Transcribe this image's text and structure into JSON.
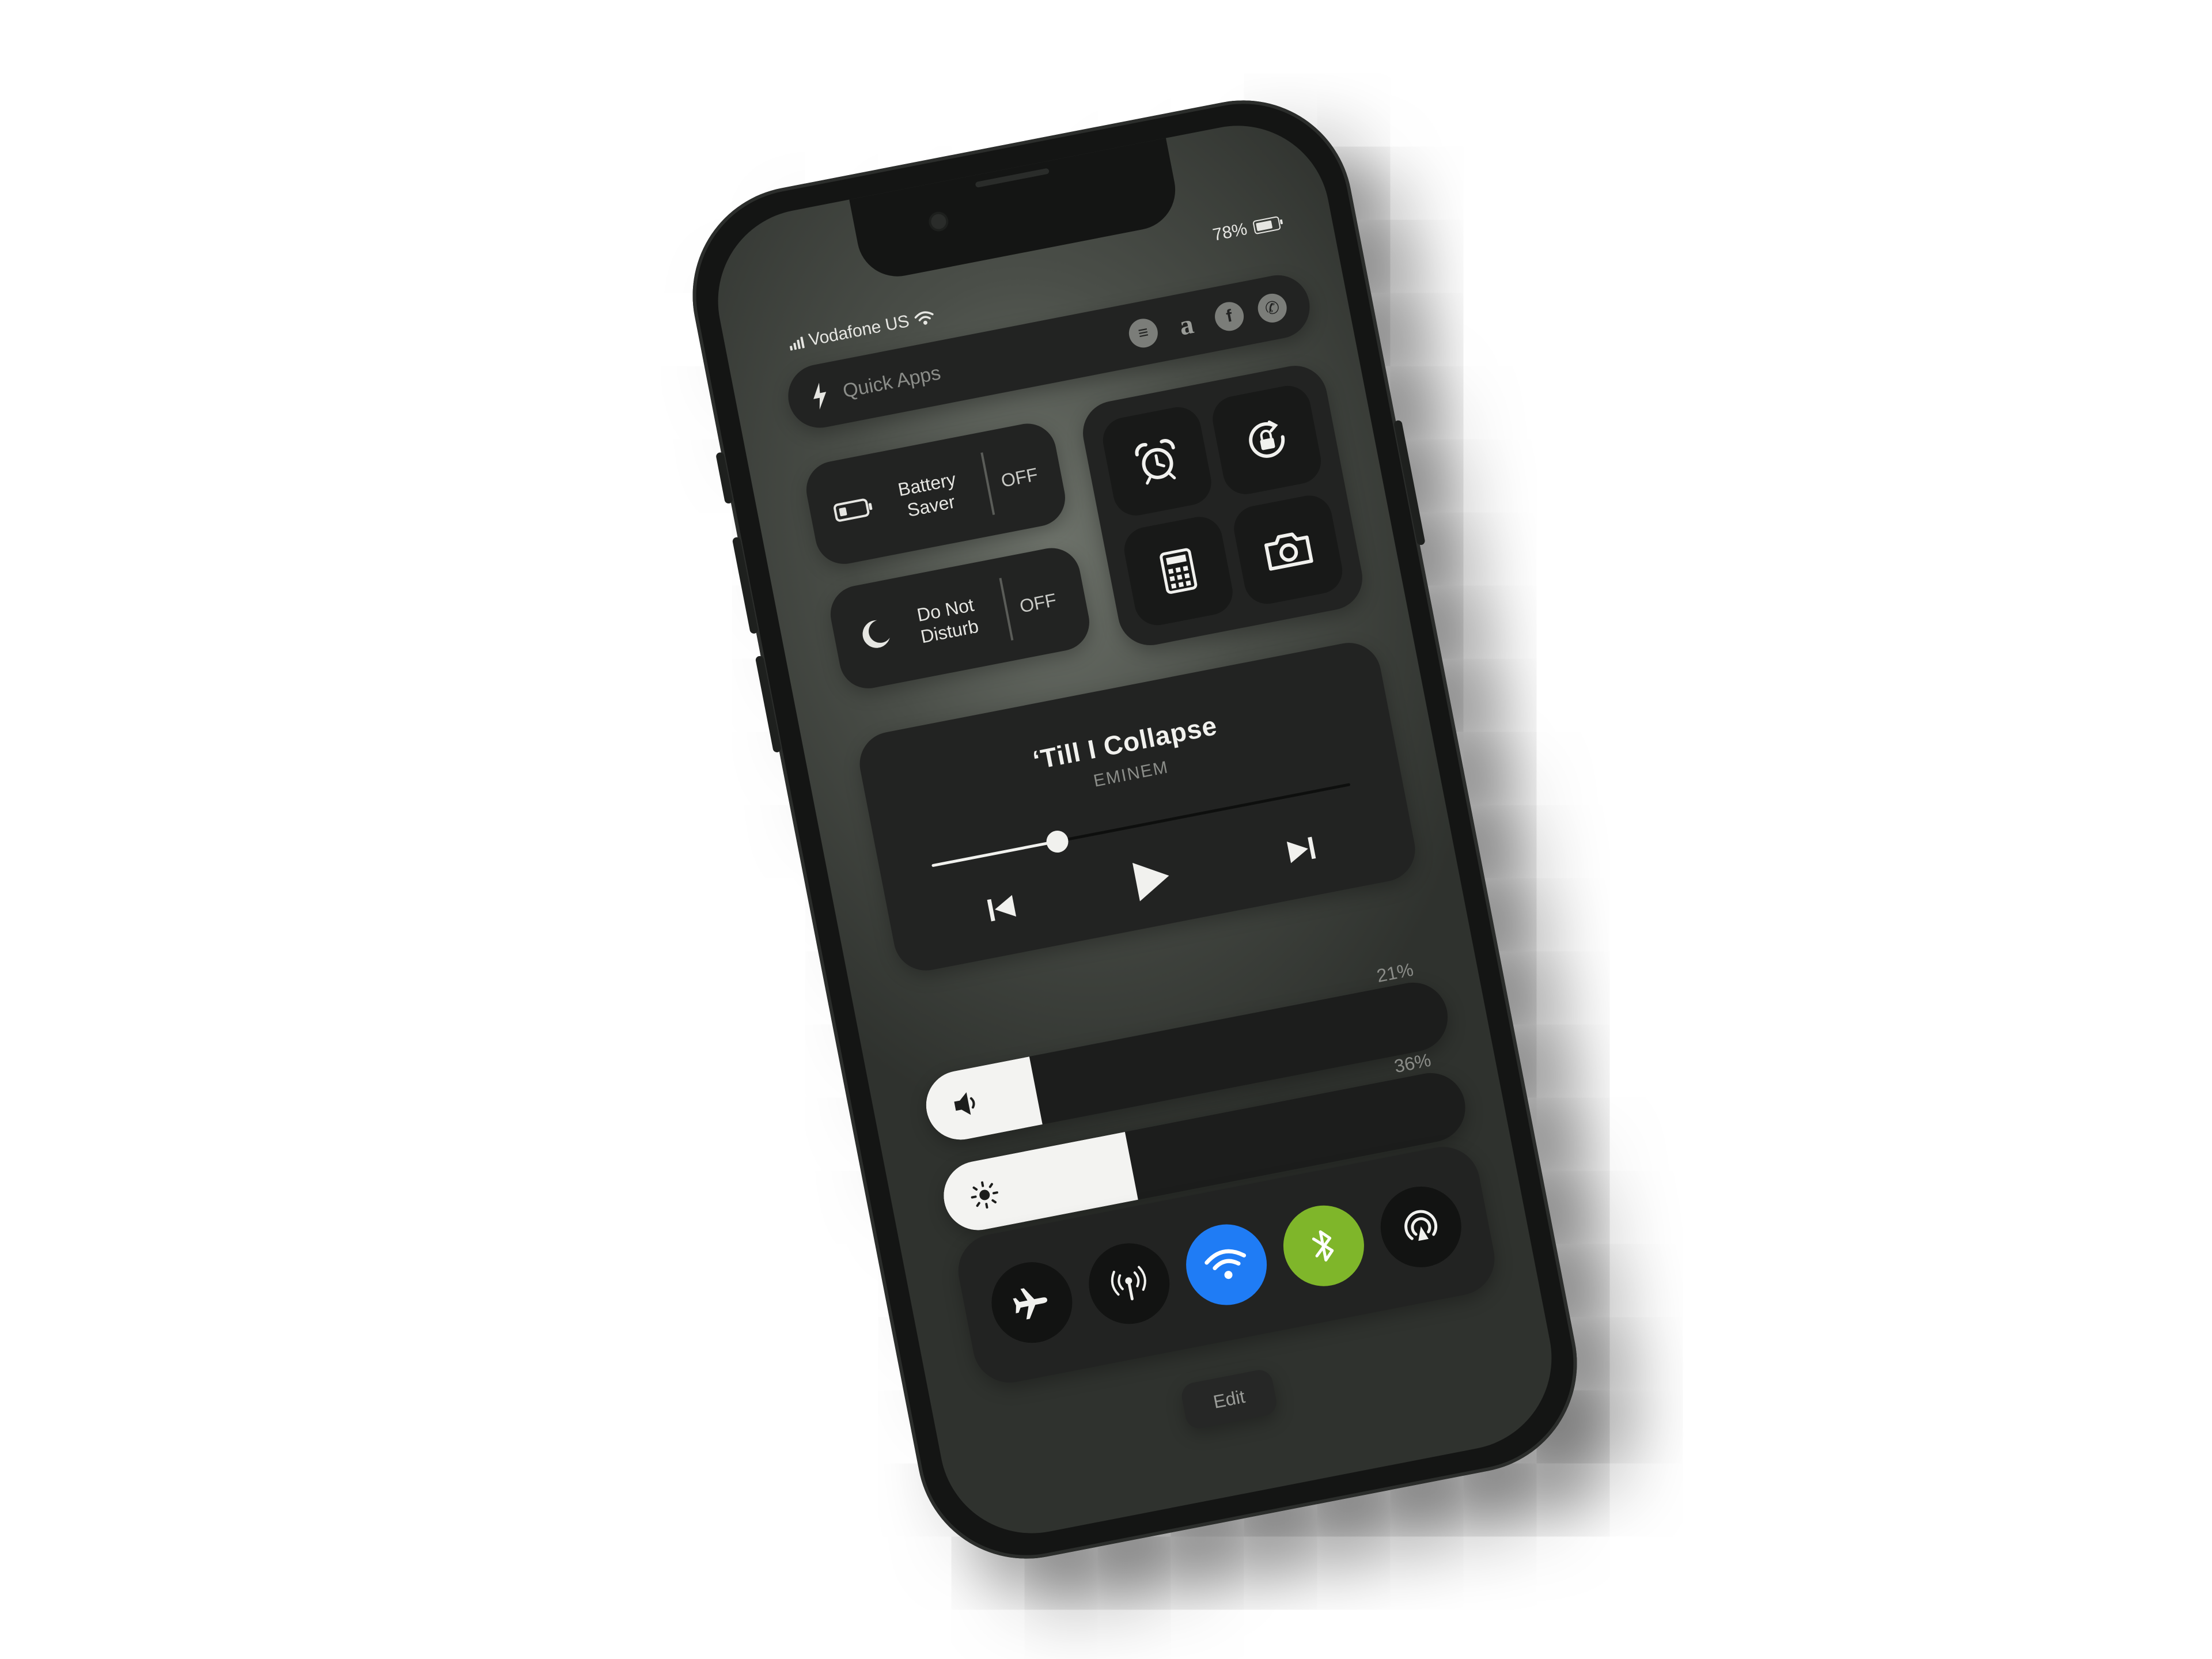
{
  "status_bar": {
    "carrier": "Vodafone US",
    "battery_percent": "78%",
    "battery_level": 0.78
  },
  "quick_apps": {
    "label": "Quick Apps",
    "apps": [
      {
        "name": "spotify-icon",
        "glyph": "≡"
      },
      {
        "name": "amazon-icon",
        "glyph": "a"
      },
      {
        "name": "facebook-icon",
        "glyph": "f"
      },
      {
        "name": "whatsapp-icon",
        "glyph": "✆"
      }
    ]
  },
  "toggles": {
    "battery_saver": {
      "label_line1": "Battery",
      "label_line2": "Saver",
      "state": "OFF"
    },
    "do_not_disturb": {
      "label_line1": "Do Not",
      "label_line2": "Disturb",
      "state": "OFF"
    }
  },
  "shortcuts": [
    "alarm-clock-icon",
    "rotation-lock-icon",
    "calculator-icon",
    "camera-icon"
  ],
  "now_playing": {
    "title": "‘Till I Collapse",
    "artist": "EMINEM",
    "progress": 0.3
  },
  "volume": {
    "percent_label": "21%",
    "level": 0.21
  },
  "brightness": {
    "percent_label": "36%",
    "level": 0.36
  },
  "connectivity": [
    {
      "name": "airplane-mode",
      "active": false
    },
    {
      "name": "cellular-data",
      "active": false
    },
    {
      "name": "wifi",
      "active": true,
      "color": "#1f7cf5"
    },
    {
      "name": "bluetooth",
      "active": true,
      "color": "#7fb62a"
    },
    {
      "name": "airdrop",
      "active": false
    }
  ],
  "edit_button": {
    "label": "Edit"
  }
}
